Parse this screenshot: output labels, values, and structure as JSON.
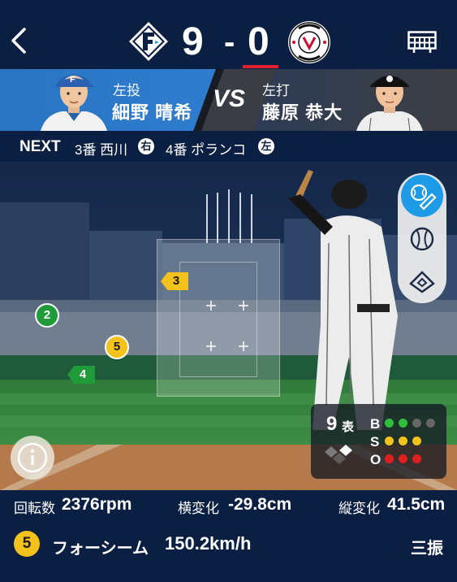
{
  "scoreboard": {
    "home_team_logo": "fighters-f-logo",
    "away_team_logo": "marines-chiba-lotte-logo",
    "away_logo_text": "MARINES CHIBA LOTTE",
    "home_score": "9",
    "dash": "-",
    "away_score": "0"
  },
  "matchup": {
    "pitcher_position": "左投",
    "pitcher_name": "細野 晴希",
    "vs": "VS",
    "batter_position": "左打",
    "batter_name": "藤原 恭大"
  },
  "next": {
    "label": "NEXT",
    "batter3": "3番 西川",
    "batter3_hand": "右",
    "batter4": "4番 ポランコ",
    "batter4_hand": "左"
  },
  "pitches": [
    {
      "num": "2",
      "color": "#1f9b3a",
      "shape": "circle"
    },
    {
      "num": "3",
      "color": "#f4c21c",
      "shape": "flag"
    },
    {
      "num": "4",
      "color": "#1f9b3a",
      "shape": "flag"
    },
    {
      "num": "5",
      "color": "#f4c21c",
      "shape": "circle"
    }
  ],
  "tools": [
    "batting-view-icon",
    "ball-icon",
    "field-icon"
  ],
  "count": {
    "inning": "9",
    "half": "表",
    "b_label": "B",
    "s_label": "S",
    "o_label": "O",
    "balls": 2,
    "strikes": 3,
    "outs": 3
  },
  "stats": {
    "spin_label": "回転数",
    "spin_value": "2376rpm",
    "horizontal_label": "横変化",
    "horizontal_value": "-29.8cm",
    "vertical_label": "縦変化",
    "vertical_value": "41.5cm"
  },
  "last_pitch": {
    "number": "5",
    "type": "フォーシーム",
    "speed": "150.2km/h",
    "result": "三振"
  },
  "colors": {
    "navy": "#0b1f42",
    "accent_blue": "#1e9be6",
    "score_red": "#e01f2d",
    "yellow": "#f4c21c",
    "green": "#1f9b3a"
  }
}
